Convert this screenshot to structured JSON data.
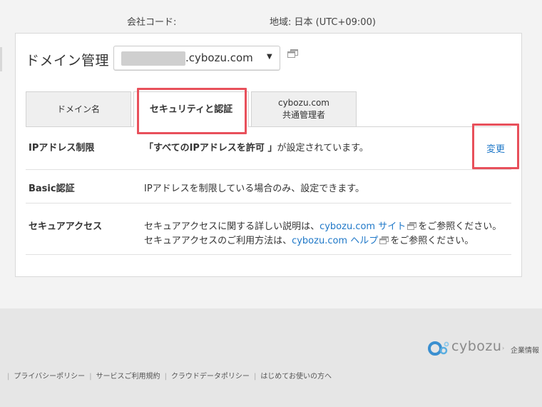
{
  "header": {
    "company_code_label": "会社コード:",
    "region_label": "地域: 日本 (UTC+09:00)"
  },
  "domain": {
    "title": "ドメイン管理",
    "selected_value": ".cybozu.com",
    "dropdown_arrow": "▼"
  },
  "tabs": [
    {
      "label": "ドメイン名"
    },
    {
      "label": "セキュリティと認証"
    },
    {
      "label_line1": "cybozu.com",
      "label_line2": "共通管理者"
    }
  ],
  "rows": {
    "ip_restriction": {
      "label": "IPアドレス制限",
      "value_bold": "「すべてのIPアドレスを許可 」",
      "value_rest": "が設定されています。",
      "action_label": "変更"
    },
    "basic_auth": {
      "label": "Basic認証",
      "value": "IPアドレスを制限している場合のみ、設定できます。"
    },
    "secure_access": {
      "label": "セキュアアクセス",
      "line1_prefix": "セキュアアクセスに関する詳しい説明は、",
      "line1_link": "cybozu.com サイト",
      "line1_suffix": "をご参照ください。",
      "line2_prefix": "セキュアアクセスのご利用方法は、",
      "line2_link": "cybozu.com ヘルプ",
      "line2_suffix": "をご参照ください。"
    }
  },
  "footer": {
    "brand": "cybozu",
    "separator": "›",
    "corporate_link": "企業情報",
    "links": [
      "プライバシーポリシー",
      "サービスご利用規約",
      "クラウドデータポリシー",
      "はじめてお使いの方へ"
    ]
  },
  "colors": {
    "link": "#1f78c8",
    "highlight": "#e8505b",
    "footer_bg": "#e6e6e6",
    "page_bg": "#f3f3f3"
  }
}
